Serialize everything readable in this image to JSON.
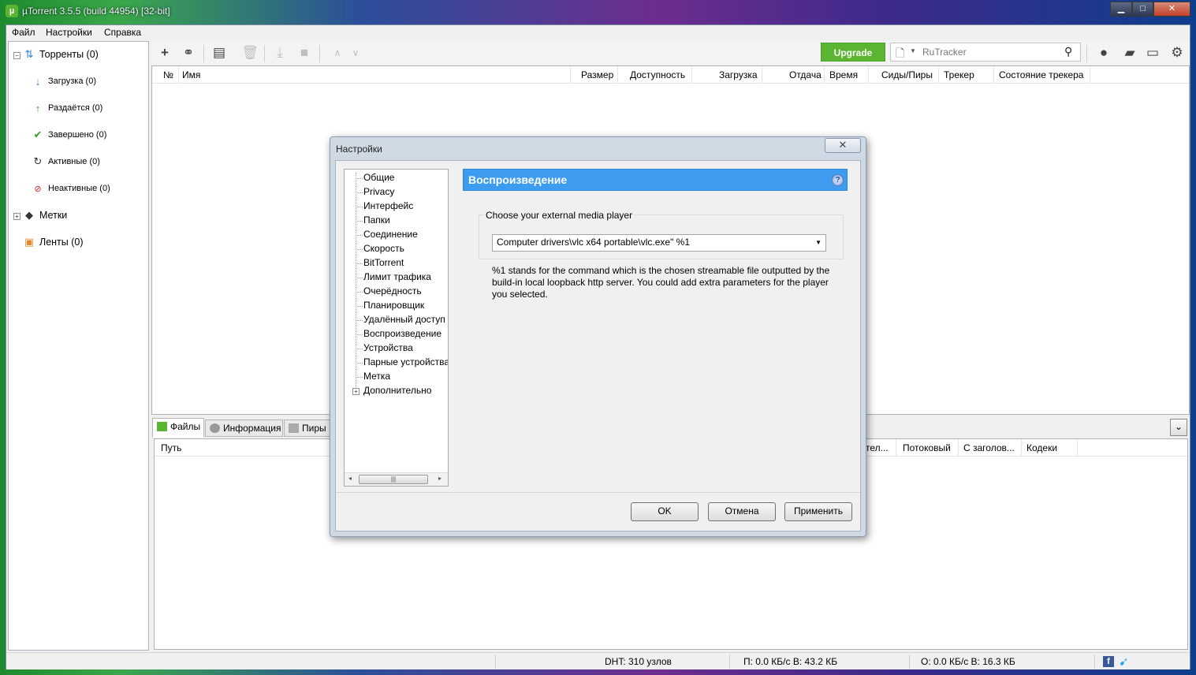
{
  "window": {
    "title": "µTorrent 3.5.5  (build 44954) [32-bit]",
    "controls": {
      "minimize": "▁",
      "maximize": "□",
      "close": "✕"
    }
  },
  "menu": [
    "Файл",
    "Настройки",
    "Справка"
  ],
  "sidebar": {
    "torrents": "Торренты (0)",
    "items": [
      {
        "label": "Загрузка (0)",
        "icon": "arrow-down-icon"
      },
      {
        "label": "Раздаётся (0)",
        "icon": "arrow-up-icon"
      },
      {
        "label": "Завершено (0)",
        "icon": "checkmark-icon"
      },
      {
        "label": "Активные (0)",
        "icon": "refresh-icon"
      },
      {
        "label": "Неактивные (0)",
        "icon": "inactive-icon"
      }
    ],
    "labels": "Метки",
    "feeds": "Ленты (0)"
  },
  "toolbar": {
    "upgrade": "Upgrade",
    "search_placeholder": "RuTracker"
  },
  "list": {
    "columns": [
      "№",
      "Имя",
      "Размер",
      "Доступность",
      "Загрузка",
      "Отдача",
      "Время",
      "Сиды/Пиры",
      "Трекер",
      "Состояние трекера"
    ]
  },
  "tabs": [
    "Файлы",
    "Информация",
    "Пиры"
  ],
  "files": {
    "columns": [
      "Путь",
      "тел...",
      "Потоковый",
      "С заголов...",
      "Кодеки"
    ]
  },
  "status": {
    "dht": "DHT: 310 узлов",
    "download": "П: 0.0 КБ/с В: 43.2 КБ",
    "upload": "О: 0.0 КБ/с В: 16.3 КБ"
  },
  "dialog": {
    "title": "Настройки",
    "close": "✕",
    "tree": [
      "Общие",
      "Privacy",
      "Интерфейс",
      "Папки",
      "Соединение",
      "Скорость",
      "BitTorrent",
      "Лимит трафика",
      "Очерёдность",
      "Планировщик",
      "Удалённый доступ",
      "Воспроизведение",
      "Устройства",
      "Парные устройства",
      "Метка",
      "Дополнительно"
    ],
    "panel_title": "Воспроизведение",
    "help": "?",
    "group_label": "Choose your external media player",
    "player_value": "Computer drivers\\vlc x64 portable\\vlc.exe\" %1",
    "hint": "%1 stands for the command which is the chosen streamable file outputted by the build-in local loopback http server. You could add extra parameters for the player you selected.",
    "buttons": {
      "ok": "OK",
      "cancel": "Отмена",
      "apply": "Применить"
    }
  }
}
